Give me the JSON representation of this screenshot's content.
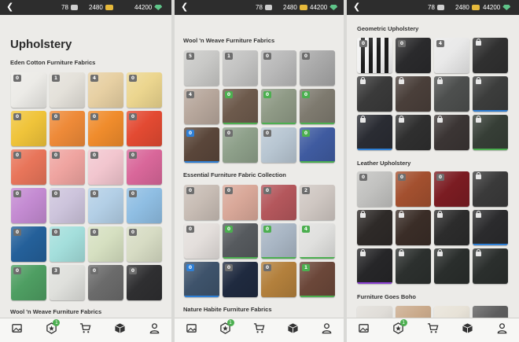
{
  "colors": {
    "topbar": "#2d2d2d",
    "badge_gray": "#6e6e6e",
    "badge_green": "#4caf50",
    "badge_blue": "#2f80d6",
    "underline_blue": "#2f80d6",
    "underline_green": "#4caf50",
    "underline_purple": "#8a3fd1"
  },
  "topbar": {
    "back_icon": "chevron-left-icon",
    "tickets": "78",
    "coins": "2480",
    "gems": "44200"
  },
  "bottom_nav": {
    "items": [
      {
        "icon": "gallery-icon"
      },
      {
        "icon": "star-hexagon-icon",
        "badge": "1"
      },
      {
        "icon": "cart-icon"
      },
      {
        "icon": "box-icon"
      },
      {
        "icon": "profile-icon"
      }
    ]
  },
  "panels": [
    {
      "heading": "Upholstery",
      "sections": [
        {
          "title": "Eden Cotton Furniture Fabrics",
          "swatches": [
            {
              "color": "#ecebe7",
              "badge": "0"
            },
            {
              "color": "#e4e1da",
              "badge": "1"
            },
            {
              "color": "#e7d0a3",
              "badge": "4"
            },
            {
              "color": "#ecd68f",
              "badge": "0"
            },
            {
              "color": "#f0c43a",
              "badge": "0"
            },
            {
              "color": "#ee8a38",
              "badge": "0"
            },
            {
              "color": "#f08c2c",
              "badge": "0"
            },
            {
              "color": "#e34a32",
              "badge": "0"
            },
            {
              "color": "#e8755a",
              "badge": "0"
            },
            {
              "color": "#efa4a0",
              "badge": "0"
            },
            {
              "color": "#f2c6cf",
              "badge": "0"
            },
            {
              "color": "#d9679a",
              "badge": "0"
            },
            {
              "color": "#c48bd2",
              "badge": "0"
            },
            {
              "color": "#cdc4dc",
              "badge": "0"
            },
            {
              "color": "#b3cfe6",
              "badge": "0"
            },
            {
              "color": "#8fbee3",
              "badge": "0"
            },
            {
              "color": "#24609a",
              "badge": "0"
            },
            {
              "color": "#a4dfdc",
              "badge": "0"
            },
            {
              "color": "#d6e0c1",
              "badge": "0"
            },
            {
              "color": "#d7dcc4",
              "badge": "0"
            },
            {
              "color": "#4e9e62",
              "badge": "0"
            },
            {
              "color": "#dfe0dc",
              "badge": "3"
            },
            {
              "color": "#6b6b6b",
              "badge": "0"
            },
            {
              "color": "#2f2f31",
              "badge": "0"
            }
          ]
        },
        {
          "title": "Wool 'n Weave Furniture Fabrics",
          "swatches": []
        }
      ]
    },
    {
      "heading": "",
      "sections": [
        {
          "title": "Wool 'n Weave Furniture Fabrics",
          "swatches": [
            {
              "color": "#c9c9c7",
              "badge": "5"
            },
            {
              "color": "#c3c3c2",
              "badge": "1"
            },
            {
              "color": "#b9b9b9",
              "badge": "0"
            },
            {
              "color": "#a8a8a8",
              "badge": "0"
            },
            {
              "color": "#b7a79c",
              "badge": "4"
            },
            {
              "color": "#6d5a4c",
              "badge": "0",
              "badge_style": "green",
              "underline": "green"
            },
            {
              "color": "#8f9a86",
              "badge": "0",
              "badge_style": "green",
              "underline": "green"
            },
            {
              "color": "#7e7a6f",
              "badge": "0",
              "badge_style": "green",
              "underline": "green"
            },
            {
              "color": "#5a463a",
              "badge": "0",
              "badge_style": "blue",
              "underline": "blue"
            },
            {
              "color": "#8ea08a",
              "badge": "0"
            },
            {
              "color": "#b8c6d2",
              "badge": "0"
            },
            {
              "color": "#3f5ba0",
              "badge": "0",
              "badge_style": "green",
              "underline": "green"
            }
          ]
        },
        {
          "title": "Essential Furniture Fabric Collection",
          "swatches": [
            {
              "color": "#c8bdb5",
              "badge": "0"
            },
            {
              "color": "#d9a899",
              "badge": "0"
            },
            {
              "color": "#b4575c",
              "badge": "0"
            },
            {
              "color": "#cfc7c2",
              "badge": "2"
            },
            {
              "color": "#e4dfdc",
              "badge": "0"
            },
            {
              "color": "#565a5e",
              "badge": "0",
              "badge_style": "green",
              "underline": "green"
            },
            {
              "color": "#a9b6c4",
              "badge": "0",
              "badge_style": "green",
              "underline": "green"
            },
            {
              "color": "#e0e0de",
              "badge": "4",
              "badge_style": "green",
              "underline": "green"
            },
            {
              "color": "#3e536b",
              "badge": "0",
              "badge_style": "blue",
              "underline": "blue"
            },
            {
              "color": "#1f2a3f",
              "badge": "0"
            },
            {
              "color": "#b3803c",
              "badge": "0"
            },
            {
              "color": "#6b4739",
              "badge": "1",
              "badge_style": "green",
              "underline": "green"
            }
          ]
        },
        {
          "title": "Nature Habite Furniture Fabrics",
          "swatches": []
        }
      ]
    },
    {
      "heading": "",
      "sections": [
        {
          "title": "Geometric Upholstery",
          "swatches": [
            {
              "color": "#ffffff",
              "badge": "0",
              "pattern": "stripes"
            },
            {
              "color": "#2a2a2c",
              "badge": "0"
            },
            {
              "color": "#e9e9e9",
              "badge": "4"
            },
            {
              "color": "#303030",
              "lock": true
            },
            {
              "color": "#3a3a3a",
              "lock": true
            },
            {
              "color": "#4a3f3a",
              "lock": true
            },
            {
              "color": "#4d4f4e",
              "lock": true
            },
            {
              "color": "#3c3d3c",
              "lock": true,
              "underline": "blue"
            },
            {
              "color": "#2a2c33",
              "lock": true,
              "underline": "blue"
            },
            {
              "color": "#2f2f2f",
              "lock": true
            },
            {
              "color": "#3b3534",
              "lock": true
            },
            {
              "color": "#363e36",
              "lock": true,
              "underline": "green"
            }
          ]
        },
        {
          "title": "Leather Upholstery",
          "swatches": [
            {
              "color": "#c2c2c0",
              "badge": "0"
            },
            {
              "color": "#a3502f",
              "badge": "0"
            },
            {
              "color": "#7b1c22",
              "badge": "0"
            },
            {
              "color": "#3a3a3a",
              "lock": true
            },
            {
              "color": "#2e2a28",
              "lock": true
            },
            {
              "color": "#3a2d27",
              "lock": true
            },
            {
              "color": "#2c2c2c",
              "lock": true
            },
            {
              "color": "#2b2b2d",
              "lock": true,
              "underline": "blue"
            },
            {
              "color": "#262628",
              "lock": true,
              "underline": "purple"
            },
            {
              "color": "#2c302e",
              "lock": true
            },
            {
              "color": "#2a2e2c",
              "lock": true
            },
            {
              "color": "#2b2f2d",
              "lock": true
            }
          ]
        },
        {
          "title": "Furniture Goes Boho",
          "swatches": []
        }
      ]
    }
  ]
}
